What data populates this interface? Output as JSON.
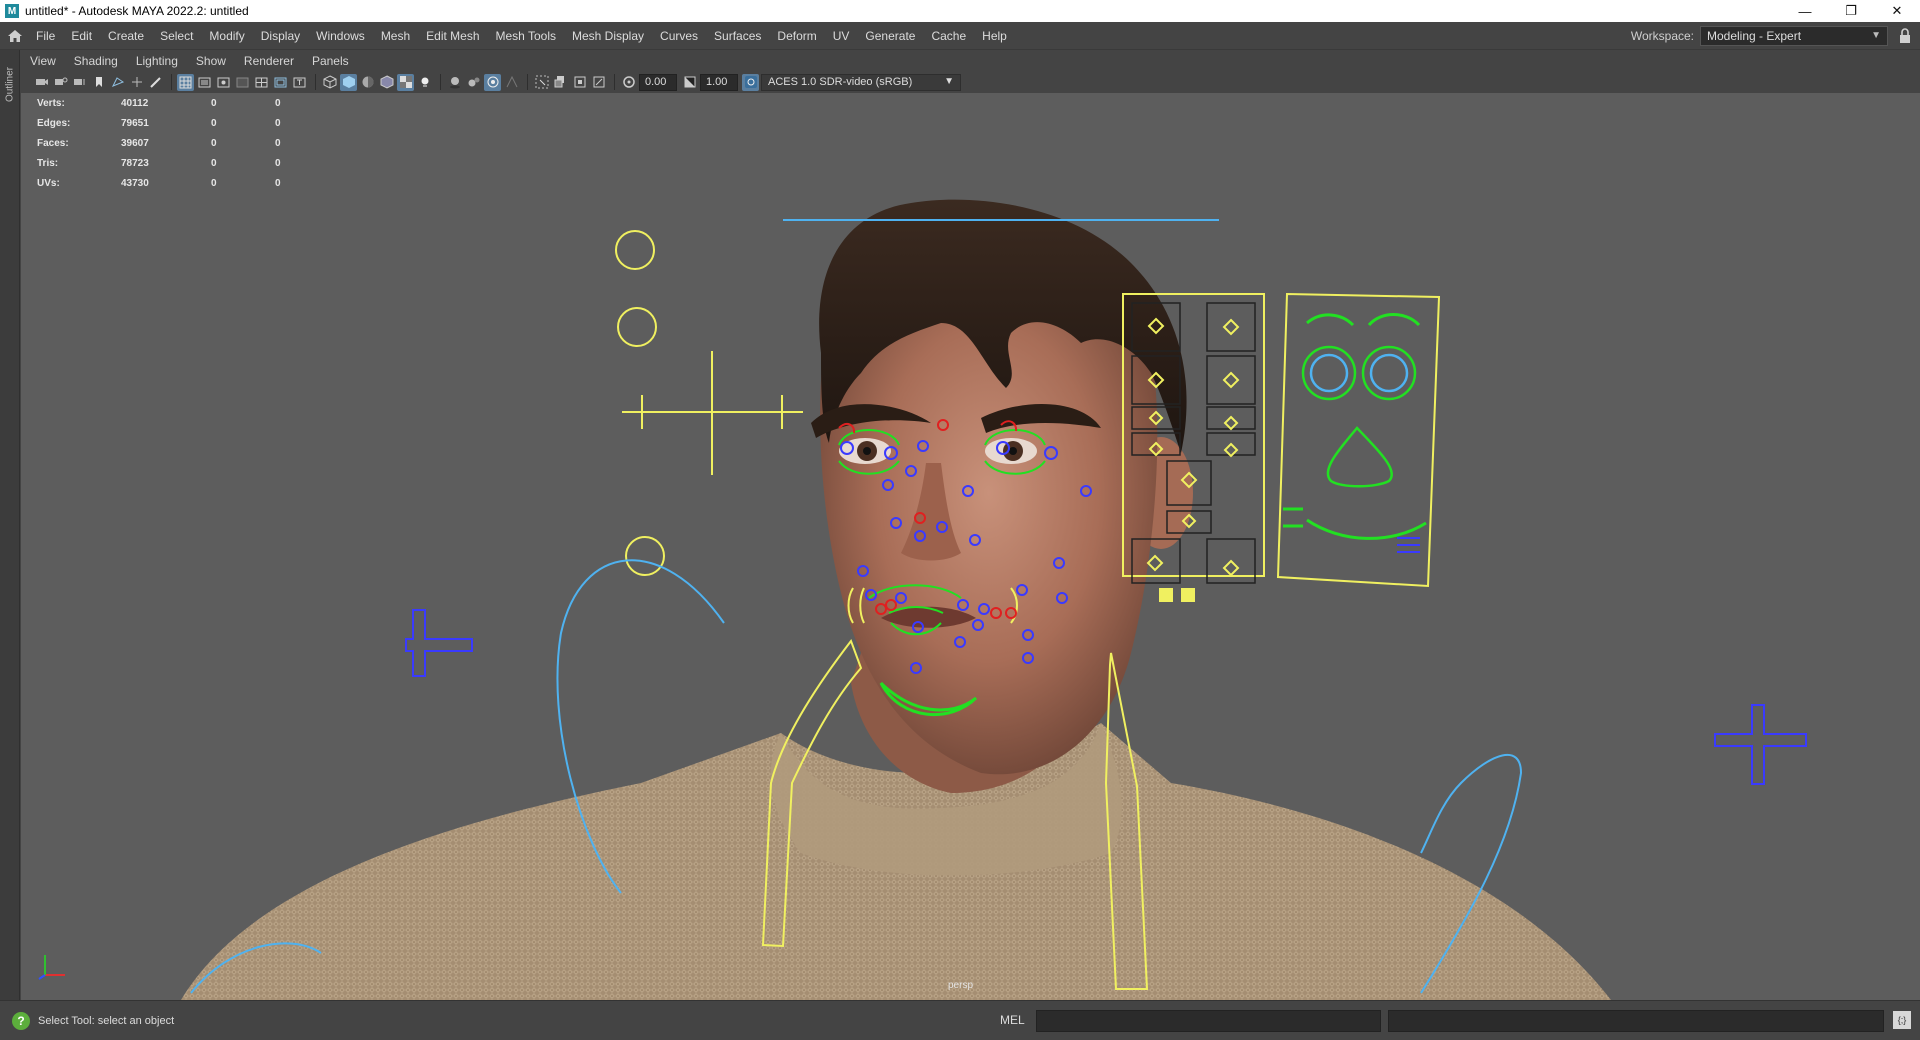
{
  "window": {
    "app_icon": "M",
    "title": "untitled* - Autodesk MAYA 2022.2: untitled",
    "controls": [
      "minimize-icon",
      "restore-icon",
      "close-icon"
    ]
  },
  "menubar": {
    "items": [
      "File",
      "Edit",
      "Create",
      "Select",
      "Modify",
      "Display",
      "Windows",
      "Mesh",
      "Edit Mesh",
      "Mesh Tools",
      "Mesh Display",
      "Curves",
      "Surfaces",
      "Deform",
      "UV",
      "Generate",
      "Cache",
      "Help"
    ],
    "workspace_label": "Workspace:",
    "workspace_value": "Modeling - Expert"
  },
  "leftstrip": {
    "outliner_label": "Outliner"
  },
  "panel_menu": {
    "items": [
      "View",
      "Shading",
      "Lighting",
      "Show",
      "Renderer",
      "Panels"
    ]
  },
  "panel_toolbar": {
    "exposure": "0.00",
    "gamma": "1.00",
    "color_space": "ACES 1.0 SDR-video (sRGB)"
  },
  "hud": {
    "rows": [
      {
        "label": "Verts:",
        "v1": "40112",
        "v2": "0",
        "v3": "0"
      },
      {
        "label": "Edges:",
        "v1": "79651",
        "v2": "0",
        "v3": "0"
      },
      {
        "label": "Faces:",
        "v1": "39607",
        "v2": "0",
        "v3": "0"
      },
      {
        "label": "Tris:",
        "v1": "78723",
        "v2": "0",
        "v3": "0"
      },
      {
        "label": "UVs:",
        "v1": "43730",
        "v2": "0",
        "v3": "0"
      }
    ]
  },
  "viewport": {
    "camera_label": "persp"
  },
  "statusbar": {
    "help_text": "Select Tool: select an object",
    "mel_label": "MEL"
  },
  "colors": {
    "ui_bg": "#444444",
    "viewport_bg": "#5d5d5d",
    "rig_yellow": "#f0f060",
    "rig_green": "#22e022",
    "rig_blue": "#3a3aff",
    "rig_cyan": "#4fb2f0",
    "rig_red": "#e02020"
  }
}
